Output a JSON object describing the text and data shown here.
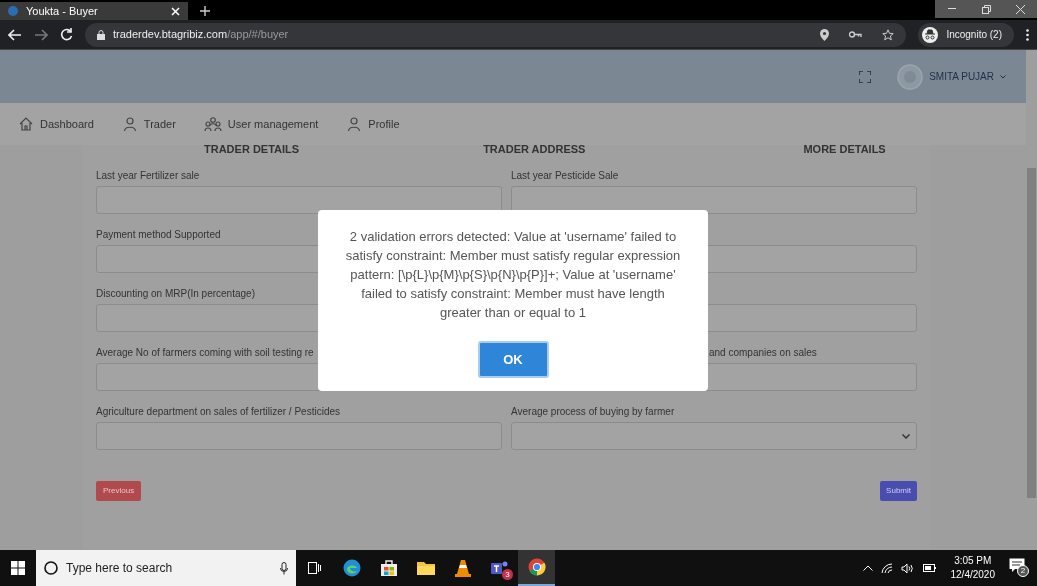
{
  "browser": {
    "tab_title": "Youkta - Buyer",
    "url_host": "traderdev.btagribiz.com",
    "url_path": "/app/#/buyer",
    "profile_label": "Incognito (2)"
  },
  "header": {
    "user_name": "SMITA PUJAR"
  },
  "nav": [
    {
      "label": "Dashboard"
    },
    {
      "label": "Trader"
    },
    {
      "label": "User management"
    },
    {
      "label": "Profile"
    }
  ],
  "steps": [
    "TRADER DETAILS",
    "TRADER ADDRESS",
    "MORE DETAILS"
  ],
  "form_rows": [
    [
      {
        "label": "Last year Fertilizer sale",
        "kind": "input"
      },
      {
        "label": "Last year Pesticide Sale",
        "kind": "input"
      }
    ],
    [
      {
        "label": "Payment method Supported",
        "kind": "input"
      },
      {
        "kind": "input"
      }
    ],
    [
      {
        "label": "Discounting on MRP(In percentage)",
        "kind": "input"
      },
      {
        "kind": "input"
      }
    ],
    [
      {
        "label": "Average No of farmers coming with soil testing re",
        "kind": "input"
      },
      {
        "label": "and companies on sales",
        "kind": "input"
      }
    ],
    [
      {
        "label": "Agriculture department on sales of fertilizer / Pesticides",
        "kind": "input"
      },
      {
        "label": "Average process of buying by farmer",
        "kind": "select"
      }
    ]
  ],
  "previous_button": "Previous",
  "submit_button": "Submit",
  "dialog": {
    "message": "2 validation errors detected: Value at 'username' failed to satisfy constraint: Member must satisfy regular expression pattern: [\\p{L}\\p{M}\\p{S}\\p{N}\\p{P}]+; Value at 'username' failed to satisfy constraint: Member must have length greater than or equal to 1",
    "button": "OK"
  },
  "taskbar": {
    "search_placeholder": "Type here to search",
    "teams_badge": "3",
    "time": "3:05 PM",
    "date": "12/4/2020",
    "notification_count": "2"
  }
}
